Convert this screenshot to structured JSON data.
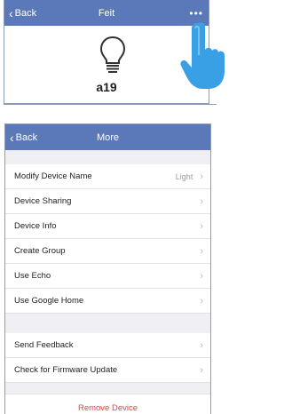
{
  "device_screen": {
    "back_label": "Back",
    "title": "Feit",
    "more_label": "•••",
    "device_name": "a19"
  },
  "more_screen": {
    "back_label": "Back",
    "title": "More",
    "items_group1": [
      {
        "label": "Modify Device Name",
        "value": "Light"
      },
      {
        "label": "Device Sharing",
        "value": ""
      },
      {
        "label": "Device Info",
        "value": ""
      },
      {
        "label": "Create Group",
        "value": ""
      },
      {
        "label": "Use Echo",
        "value": ""
      },
      {
        "label": "Use Google Home",
        "value": ""
      }
    ],
    "items_group2": [
      {
        "label": "Send Feedback",
        "value": ""
      },
      {
        "label": "Check for Firmware Update",
        "value": ""
      }
    ],
    "remove_label": "Remove Device"
  },
  "colors": {
    "navbar": "#5b78b8",
    "destructive": "#e0443a"
  }
}
